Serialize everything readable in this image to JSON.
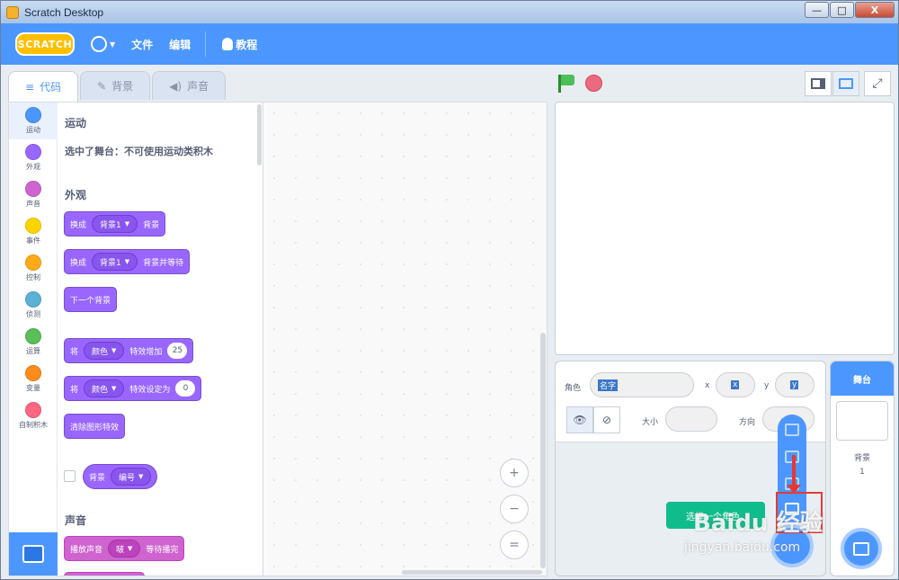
{
  "window": {
    "title": "Scratch Desktop",
    "minimize": "—",
    "maximize": "□",
    "close": "X"
  },
  "menubar": {
    "logo": "SCRATCH",
    "file": "文件",
    "edit": "编辑",
    "tutorials": "教程"
  },
  "tabs": {
    "code": "代码",
    "backdrops": "背景",
    "sounds": "声音"
  },
  "categories": [
    {
      "label": "运动",
      "color": "#4c97ff"
    },
    {
      "label": "外观",
      "color": "#9966ff"
    },
    {
      "label": "声音",
      "color": "#cf63cf"
    },
    {
      "label": "事件",
      "color": "#ffd500"
    },
    {
      "label": "控制",
      "color": "#ffab19"
    },
    {
      "label": "侦测",
      "color": "#5cb1d6"
    },
    {
      "label": "运算",
      "color": "#59c059"
    },
    {
      "label": "变量",
      "color": "#ff8c1a"
    },
    {
      "label": "自制积木",
      "color": "#ff6680"
    }
  ],
  "blocks": {
    "motion_title": "运动",
    "motion_note": "选中了舞台：不可使用运动类积木",
    "looks_title": "外观",
    "switch_backdrop": {
      "pre": "换成",
      "value": "背景1",
      "post": "背景"
    },
    "switch_backdrop_wait": {
      "pre": "换成",
      "value": "背景1",
      "post": "背景并等待"
    },
    "next_backdrop": "下一个背景",
    "change_effect": {
      "pre": "将",
      "value": "颜色",
      "mid": "特效增加",
      "num": "25"
    },
    "set_effect": {
      "pre": "将",
      "value": "颜色",
      "mid": "特效设定为",
      "num": "0"
    },
    "clear_effects": "清除图形特效",
    "backdrop_reporter": {
      "pre": "背景",
      "value": "编号"
    },
    "sound_title": "声音",
    "play_sound": {
      "pre": "播放声音",
      "value": "啵",
      "post": "等待播完"
    }
  },
  "zoom": {
    "in": "+",
    "out": "−",
    "reset": "="
  },
  "sprite_info": {
    "sprite_label": "角色",
    "name_value": "名字",
    "x_label": "x",
    "x_value": "x",
    "y_label": "y",
    "y_value": "y",
    "size_label": "大小",
    "direction_label": "方向",
    "show_icon": "👁",
    "hide_icon": "⊘"
  },
  "choose_sprite": "选择一个角色",
  "stage_pane": {
    "title": "舞台",
    "backdrops_label": "背景",
    "backdrops_count": "1"
  },
  "watermark": {
    "logo": "Baidu 经验",
    "url": "jingyan.baidu.com"
  }
}
